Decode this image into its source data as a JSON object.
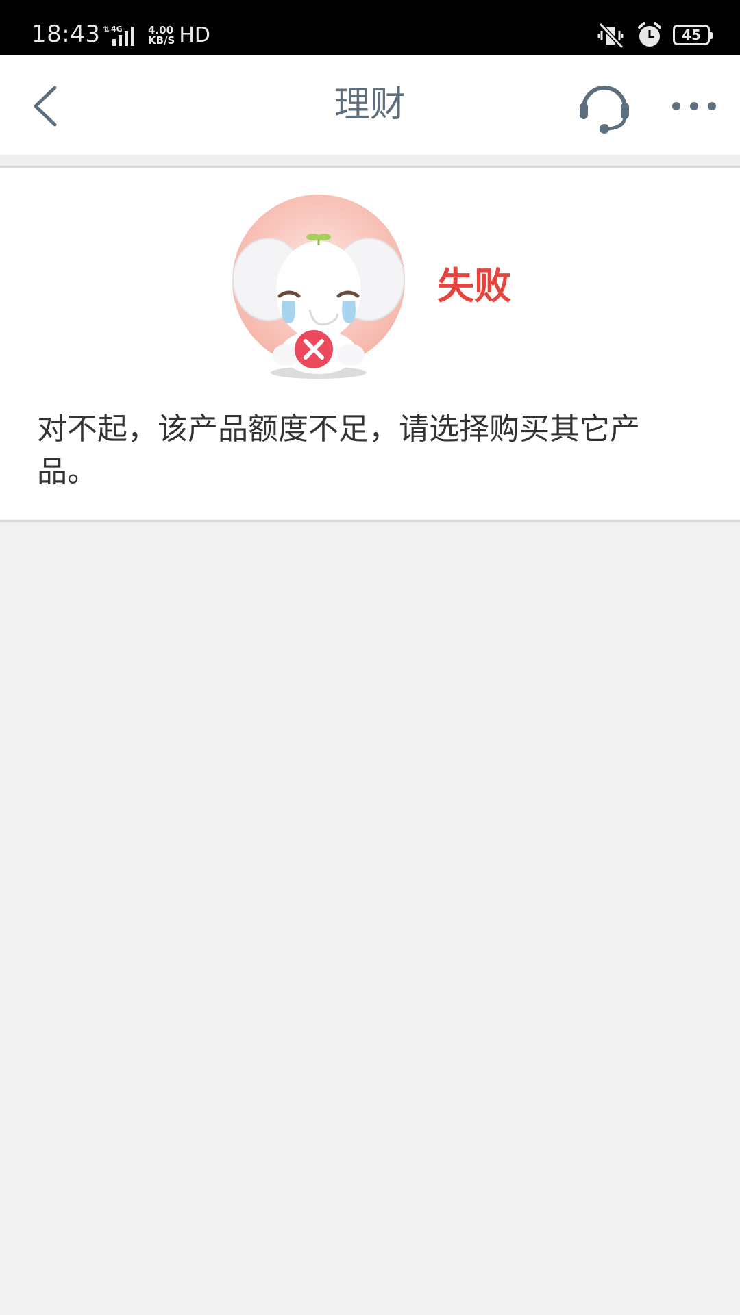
{
  "status_bar": {
    "time": "18:43",
    "network_type": "4G",
    "speed_value": "4.00",
    "speed_unit": "KB/S",
    "hd_label": "HD",
    "battery_level": "45"
  },
  "nav": {
    "title": "理财"
  },
  "result": {
    "status_text": "失败",
    "message": "对不起，该产品额度不足，请选择购买其它产品。"
  },
  "colors": {
    "status_bar_bg": "#000000",
    "nav_icon": "#5d6f7e",
    "error_red": "#e5443f",
    "page_bg": "#f3f3f3"
  },
  "icons": {
    "back": "chevron-left-icon",
    "service": "headset-icon",
    "more": "more-dots-icon",
    "mute": "vibrate-mute-icon",
    "alarm": "alarm-icon",
    "failure": "crying-elephant-mascot"
  }
}
